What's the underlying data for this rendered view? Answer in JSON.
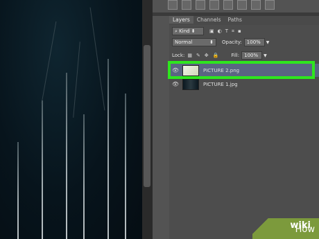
{
  "tabs": [
    "Layers",
    "Channels",
    "Paths"
  ],
  "filter": {
    "kind_label": "Kind"
  },
  "blend": {
    "mode": "Normal",
    "opacity_label": "Opacity:",
    "opacity_value": "100%"
  },
  "lock": {
    "label": "Lock:",
    "fill_label": "Fill:",
    "fill_value": "100%"
  },
  "layers": [
    {
      "name": "PICTURE 2.png",
      "selected": true
    },
    {
      "name": "PICTURE 1.jpg",
      "selected": false
    }
  ],
  "watermark": {
    "brand_a": "wiki",
    "brand_b": "How"
  },
  "colors": {
    "highlight": "#2ee61e",
    "selected_layer": "#5a6582",
    "panel": "#535353"
  }
}
